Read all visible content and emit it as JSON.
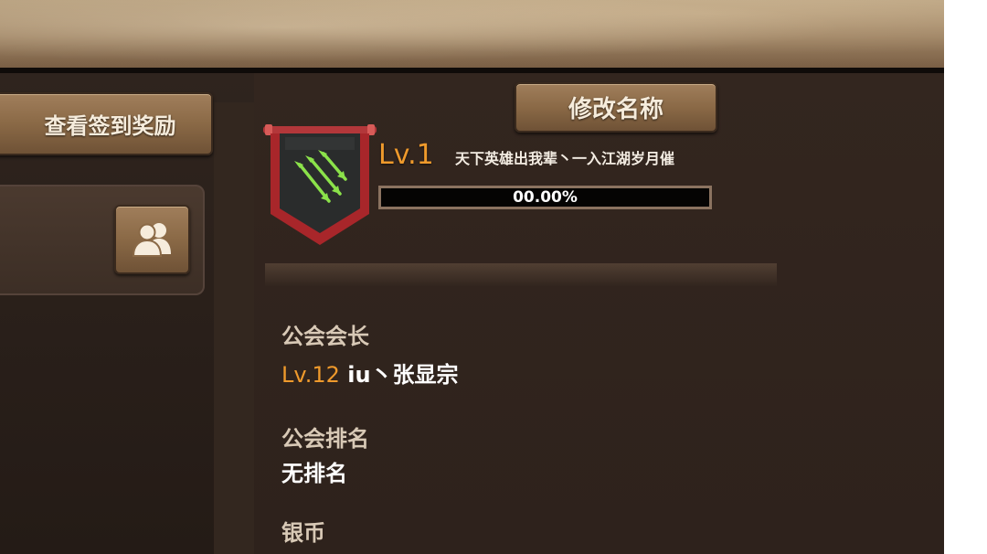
{
  "left_panel": {
    "checkin_button_label": "查看签到奖励",
    "members_icon": "group-users-icon"
  },
  "guild": {
    "rename_button_label": "修改名称",
    "emblem_icon": "three-arrows-banner-icon",
    "level": "Lv.1",
    "name": "天下英雄出我辈丶一入江湖岁月催",
    "exp_percent_text": "00.00%",
    "exp_fraction": 0.0
  },
  "info": {
    "leader_label": "公会会长",
    "leader_level": "Lv.12",
    "leader_name": "iu丶张显宗",
    "rank_label": "公会排名",
    "rank_value": "无排名",
    "silver_label": "银币"
  },
  "colors": {
    "level_orange": "#ef9a2c",
    "button_brown": "#8a6946",
    "panel_dark": "#2e221c",
    "emblem_red": "#a8262a",
    "arrow_green": "#8be24a"
  }
}
